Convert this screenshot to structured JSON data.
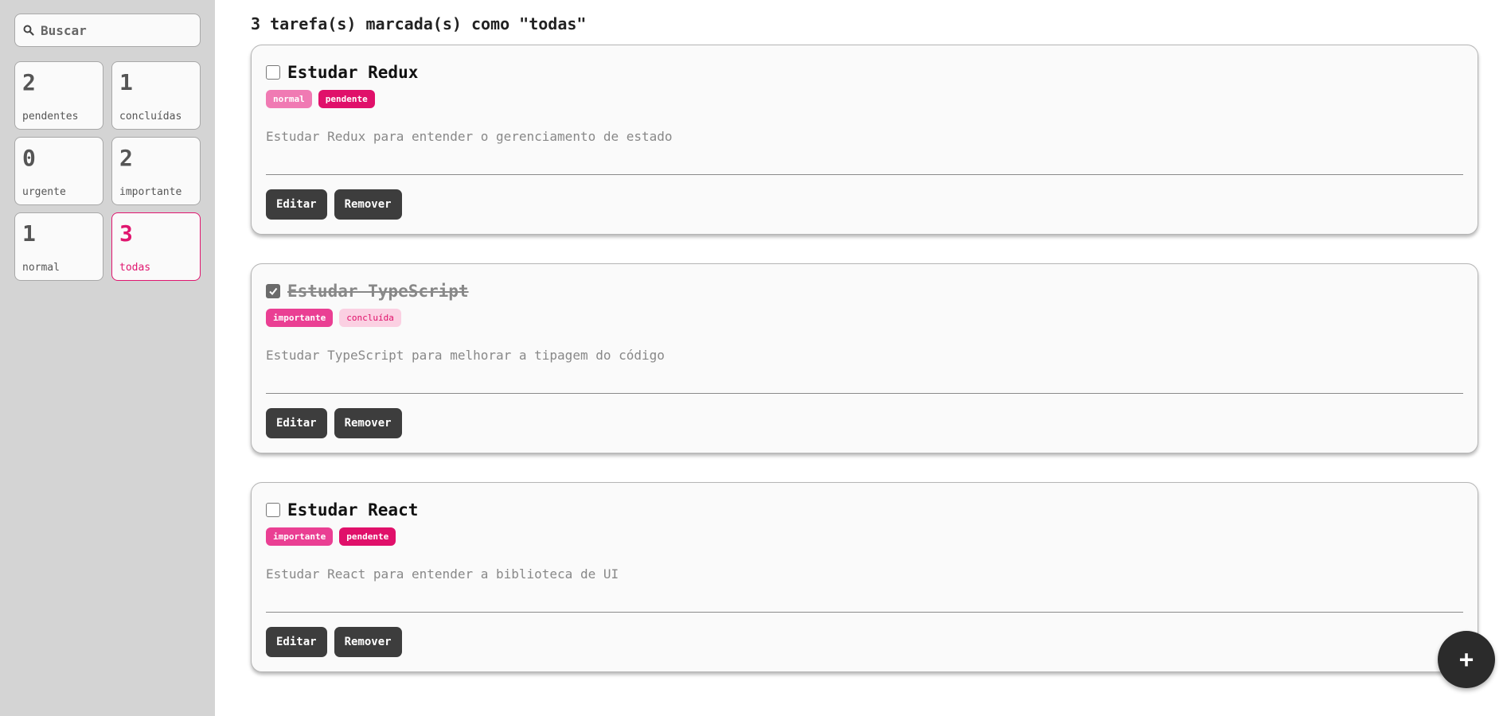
{
  "search": {
    "placeholder": "Buscar"
  },
  "filters": [
    {
      "count": "2",
      "label": "pendentes"
    },
    {
      "count": "1",
      "label": "concluídas"
    },
    {
      "count": "0",
      "label": "urgente"
    },
    {
      "count": "2",
      "label": "importante"
    },
    {
      "count": "1",
      "label": "normal"
    },
    {
      "count": "3",
      "label": "todas",
      "active": true
    }
  ],
  "heading": "3 tarefa(s) marcada(s) como \"todas\"",
  "tasks": [
    {
      "title": "Estudar Redux",
      "checked": false,
      "tags": [
        "normal",
        "pendente"
      ],
      "description": "Estudar Redux para entender o gerenciamento de estado",
      "edit_label": "Editar",
      "remove_label": "Remover"
    },
    {
      "title": "Estudar TypeScript",
      "checked": true,
      "tags": [
        "importante",
        "concluída"
      ],
      "description": "Estudar TypeScript para melhorar a tipagem do código",
      "edit_label": "Editar",
      "remove_label": "Remover"
    },
    {
      "title": "Estudar React",
      "checked": false,
      "tags": [
        "importante",
        "pendente"
      ],
      "description": "Estudar React para entender a biblioteca de UI",
      "edit_label": "Editar",
      "remove_label": "Remover"
    }
  ],
  "fab": {
    "label": "+"
  },
  "colors": {
    "accent": "#e0166f",
    "sidebar_bg": "#d4d4d4",
    "button_bg": "#3d3d3d"
  },
  "icons": {
    "search": "search-icon",
    "add": "plus-icon",
    "check": "check-icon"
  }
}
